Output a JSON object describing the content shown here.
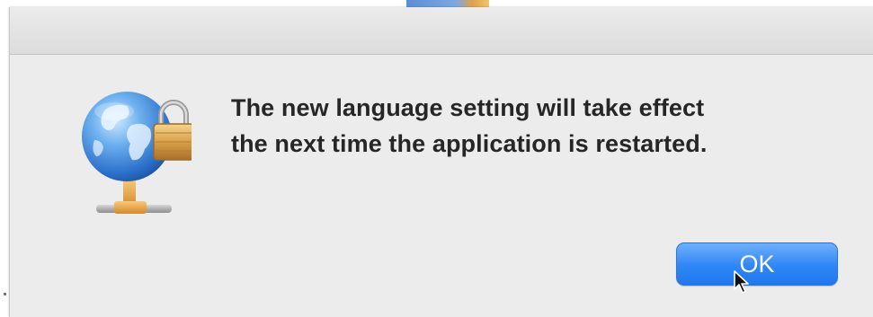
{
  "dialog": {
    "message_line1": "The new language setting will take effect",
    "message_line2": "the next time the application is restarted.",
    "ok_label": "OK",
    "icon": "network-globe-lock-icon"
  },
  "colors": {
    "dialog_background": "#ececec",
    "button_blue": "#2f86f5",
    "text": "#262626"
  }
}
